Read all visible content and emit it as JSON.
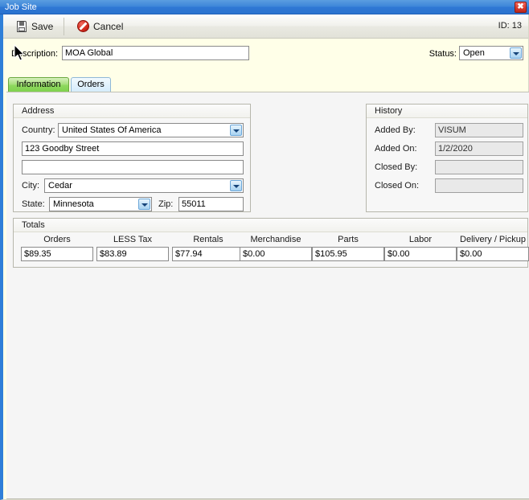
{
  "window": {
    "title": "Job Site",
    "close_icon": "close-icon"
  },
  "toolbar": {
    "save_label": "Save",
    "cancel_label": "Cancel",
    "id_label": "ID: 13"
  },
  "header": {
    "description_label": "Description:",
    "description_value": "MOA Global",
    "status_label": "Status:",
    "status_value": "Open"
  },
  "tabs": [
    {
      "label": "Information",
      "active": true
    },
    {
      "label": "Orders",
      "active": false
    }
  ],
  "address": {
    "title": "Address",
    "country_label": "Country:",
    "country_value": "United States Of America",
    "line1_value": "123 Goodby Street",
    "line2_value": "",
    "city_label": "City:",
    "city_value": "Cedar",
    "state_label": "State:",
    "state_value": "Minnesota",
    "zip_label": "Zip:",
    "zip_value": "55011"
  },
  "history": {
    "title": "History",
    "added_by_label": "Added By:",
    "added_by_value": "VISUM",
    "added_on_label": "Added On:",
    "added_on_value": "1/2/2020",
    "closed_by_label": "Closed By:",
    "closed_by_value": "",
    "closed_on_label": "Closed On:",
    "closed_on_value": ""
  },
  "totals": {
    "title": "Totals",
    "columns": [
      {
        "header": "Orders",
        "value": "$89.35"
      },
      {
        "header": "LESS Tax",
        "value": "$83.89"
      },
      {
        "header": "Rentals",
        "value": "$77.94"
      },
      {
        "header": "Merchandise",
        "value": "$0.00"
      },
      {
        "header": "Parts",
        "value": "$105.95"
      },
      {
        "header": "Labor",
        "value": "$0.00"
      },
      {
        "header": "Delivery / Pickup",
        "value": "$0.00"
      }
    ]
  },
  "colors": {
    "titlebar_blue": "#2f78d4",
    "accent_border": "#2f7fd8",
    "header_background": "#ffffe8",
    "active_tab_green": "#8ed85f",
    "inactive_tab_blue": "#d5ecfb"
  }
}
